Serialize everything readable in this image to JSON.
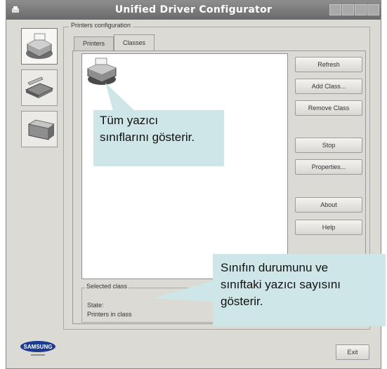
{
  "window": {
    "title": "Unified Driver Configurator"
  },
  "group": {
    "title": "Printers configuration"
  },
  "tabs": [
    {
      "label": "Printers"
    },
    {
      "label": "Classes"
    }
  ],
  "buttons": {
    "refresh": "Refresh",
    "add_class": "Add Class...",
    "remove_class": "Remove Class",
    "stop": "Stop",
    "properties": "Properties...",
    "about": "About",
    "help": "Help",
    "exit": "Exit"
  },
  "selected_class": {
    "title": "Selected class",
    "state_label": "State:",
    "printers_label": "Printers in class"
  },
  "callouts": {
    "classes_line1": "Tüm yazıcı",
    "classes_line2": "sınıflarını gösterir.",
    "status_line1": "Sınıfın durumunu ve",
    "status_line2": "sınıftaki yazıcı sayısını",
    "status_line3": "gösterir."
  },
  "logo": {
    "text": "SAMSUNG"
  },
  "colors": {
    "callout": "#cfe6e8",
    "titlebar": "#7a7a7a",
    "window": "#dcdad5"
  }
}
